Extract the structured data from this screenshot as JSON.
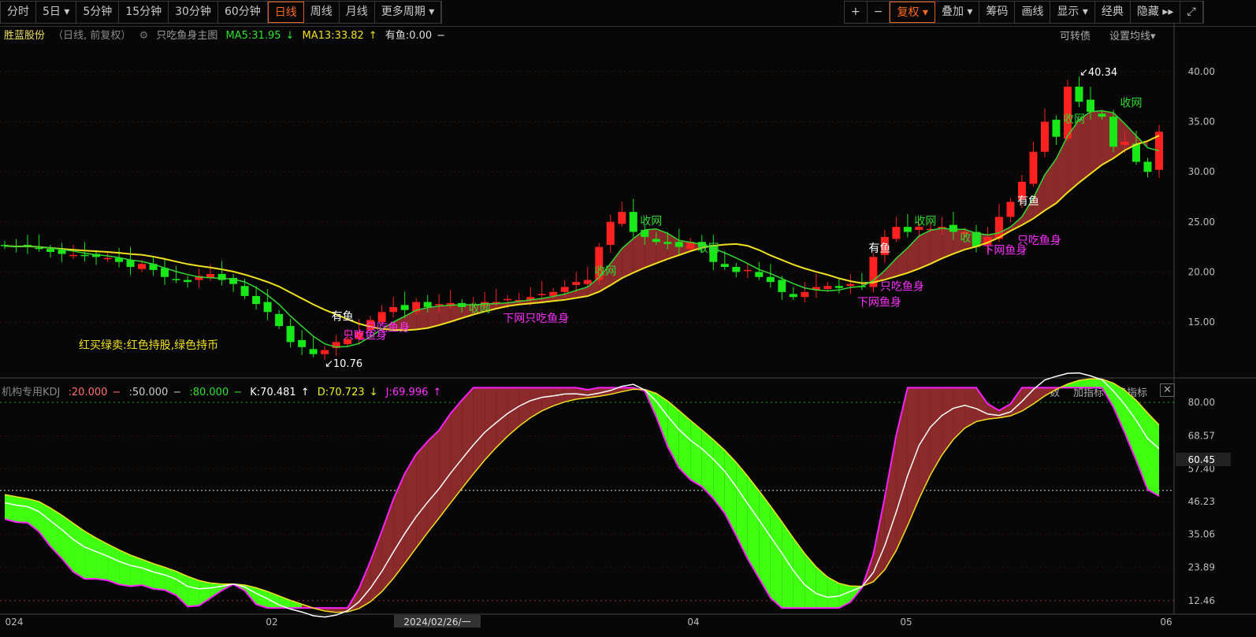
{
  "toolbar_left": [
    "分时",
    "5日 ▾",
    "5分钟",
    "15分钟",
    "30分钟",
    "60分钟",
    "日线",
    "周线",
    "月线",
    "更多周期 ▾"
  ],
  "active_period": "日线",
  "toolbar_right": [
    "+",
    "−",
    "复权 ▾",
    "叠加 ▾",
    "筹码",
    "画线",
    "显示 ▾",
    "经典",
    "隐藏 ▸▸",
    "⤢"
  ],
  "header": {
    "stock": "胜蓝股份",
    "mode": "（日线, 前复权）",
    "formula": "只吃鱼身主图",
    "ma5": "MA5:31.95",
    "ma5_arrow": "↓",
    "ma13": "MA13:33.82",
    "ma13_arrow": "↑",
    "youyu": "有鱼:0.00",
    "dash": "−",
    "right1": "可转债",
    "right2": "设置均线▾"
  },
  "kdj_header": {
    "name": "机构专用KDJ",
    "l20": ":20.000",
    "l50": ":50.000",
    "l80": ":80.000",
    "k": "K:70.481",
    "d": "D:70.723",
    "j": "J:69.996",
    "btn1": "改参数",
    "btn2": "加指标",
    "btn3": "换指标",
    "close": "✕"
  },
  "legend_text": "红买绿卖:红色持股,绿色持币",
  "colors": {
    "up": "#ff2020",
    "down": "#18e818",
    "ma5": "#30d830",
    "ma13": "#f0e020",
    "fill": "#8b2a2a"
  },
  "chart_data": {
    "type": "candlestick",
    "closes": [
      22.6,
      22.5,
      22.6,
      22.3,
      22.0,
      21.8,
      21.7,
      21.6,
      21.5,
      21.4,
      21.0,
      20.5,
      20.8,
      20.2,
      19.5,
      19.2,
      19.0,
      19.6,
      19.8,
      19.2,
      18.8,
      17.6,
      16.8,
      16.0,
      14.6,
      13.0,
      12.5,
      11.8,
      12.2,
      13.0,
      13.3,
      14.0,
      15.2,
      16.0,
      16.5,
      16.2,
      17.0,
      16.5,
      16.8,
      16.9,
      16.5,
      16.8,
      17.0,
      17.0,
      17.3,
      17.2,
      17.5,
      17.8,
      18.0,
      18.5,
      19.0,
      19.2,
      22.5,
      25.0,
      26.0,
      24.0,
      23.5,
      23.0,
      22.8,
      22.5,
      23.0,
      22.5,
      21.0,
      20.5,
      20.0,
      20.2,
      19.5,
      19.0,
      18.0,
      17.5,
      18.0,
      18.5,
      18.6,
      18.4,
      18.8,
      18.5,
      21.5,
      23.5,
      24.5,
      24.0,
      24.5,
      24.3,
      24.5,
      24.0,
      24.0,
      22.5,
      23.5,
      25.5,
      27.0,
      29.0,
      32.0,
      35.0,
      33.5,
      38.5,
      37.0,
      36.0,
      35.5,
      32.5,
      33.0,
      31.0,
      30.0,
      34.0
    ],
    "price_ticks": [
      "40.00",
      "35.00",
      "30.00",
      "25.00",
      "20.00",
      "15.00"
    ],
    "kdj_ticks": [
      "80.00",
      "68.57",
      "57.40",
      "46.23",
      "35.06",
      "23.89",
      "12.46"
    ],
    "kdj_current": "60.45",
    "x_ticks": [
      "024",
      "02",
      "04",
      "05",
      "06"
    ],
    "cursor_date": "2024/02/26/一",
    "high_label": "40.34",
    "low_label": "10.76",
    "annotations": [
      {
        "i": 29,
        "p": 15.2,
        "t": "有鱼",
        "c": "#ffffff"
      },
      {
        "i": 30,
        "p": 13.3,
        "t": "只吃鱼身",
        "c": "#ff30ff"
      },
      {
        "i": 32,
        "p": 14.1,
        "t": "只吃鱼身",
        "c": "#ff30ff"
      },
      {
        "i": 41,
        "p": 16.0,
        "t": "收网",
        "c": "#30d830"
      },
      {
        "i": 44,
        "p": 15.0,
        "t": "下网只吃鱼身",
        "c": "#ff30ff"
      },
      {
        "i": 56,
        "p": 24.7,
        "t": "收网",
        "c": "#30d830"
      },
      {
        "i": 61,
        "p": 22.0,
        "t": "收网",
        "c": "#30d830"
      },
      {
        "i": 52,
        "p": 19.7,
        "t": "收网",
        "c": "#30d830"
      },
      {
        "i": 76,
        "p": 22.0,
        "t": "有鱼",
        "c": "#ffffff"
      },
      {
        "i": 77,
        "p": 18.2,
        "t": "只吃鱼身",
        "c": "#ff30ff"
      },
      {
        "i": 75,
        "p": 16.6,
        "t": "下网鱼身",
        "c": "#ff30ff"
      },
      {
        "i": 80,
        "p": 24.7,
        "t": "收网",
        "c": "#30d830"
      },
      {
        "i": 84,
        "p": 23.0,
        "t": "收网",
        "c": "#30d830"
      },
      {
        "i": 89,
        "p": 26.7,
        "t": "有鱼",
        "c": "#ffffff"
      },
      {
        "i": 89,
        "p": 22.8,
        "t": "只吃鱼身",
        "c": "#ff30ff"
      },
      {
        "i": 86,
        "p": 21.8,
        "t": "下网鱼身",
        "c": "#ff30ff"
      },
      {
        "i": 93,
        "p": 34.9,
        "t": "收网",
        "c": "#30d830"
      },
      {
        "i": 98,
        "p": 36.5,
        "t": "收网",
        "c": "#30d830"
      }
    ]
  }
}
